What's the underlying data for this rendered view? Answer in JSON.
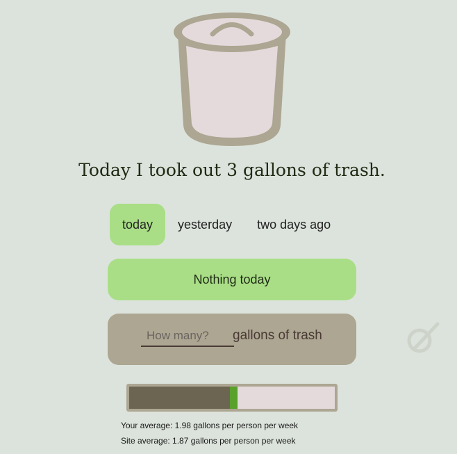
{
  "headline": "Today I took out 3 gallons of trash.",
  "tabs": [
    {
      "label": "today",
      "active": true
    },
    {
      "label": "yesterday"
    },
    {
      "label": "two days ago"
    }
  ],
  "nothing_label": "Nothing today",
  "entry": {
    "placeholder": "How many?",
    "value": "",
    "unit": "gallons of trash"
  },
  "progress": {
    "your_fraction": 0.49
  },
  "your_average": "Your average: 1.98 gallons per person per week",
  "site_average": "Site average: 1.87 gallons per person per week",
  "colors": {
    "accent": "#a9de86",
    "can": "#aca692",
    "marker": "#5aa02c"
  }
}
